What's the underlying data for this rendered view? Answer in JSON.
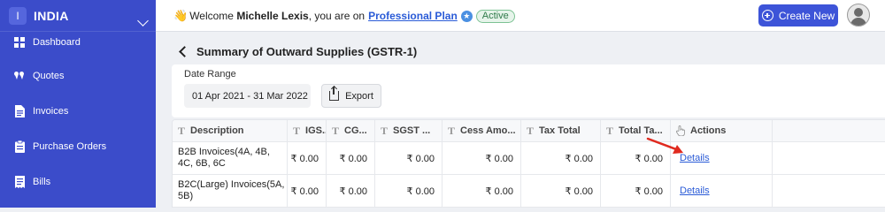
{
  "org": {
    "initial": "I",
    "name": "INDIA"
  },
  "sidebar": {
    "items": [
      {
        "label": "Dashboard",
        "icon": "dashboard-icon"
      },
      {
        "label": "Quotes",
        "icon": "quote-icon"
      },
      {
        "label": "Invoices",
        "icon": "document-icon"
      },
      {
        "label": "Purchase Orders",
        "icon": "clipboard-icon"
      },
      {
        "label": "Bills",
        "icon": "receipt-icon"
      }
    ],
    "color": "#3b4cca"
  },
  "topbar": {
    "welcome_prefix": "Welcome",
    "user_name": "Michelle Lexis",
    "welcome_suffix": ", you are on",
    "plan_name": "Professional Plan",
    "status_badge": "Active",
    "create_button": "Create New",
    "accent": "#3d54d8"
  },
  "page": {
    "title": "Summary of Outward Supplies (GSTR-1)",
    "date_range_label": "Date Range",
    "date_range_value": "01 Apr 2021 - 31 Mar 2022",
    "export_label": "Export"
  },
  "table": {
    "columns": [
      "Description",
      "IGS...",
      "CG...",
      "SGST ...",
      "Cess Amo...",
      "Tax Total",
      "Total Ta...",
      "Actions"
    ],
    "rows": [
      {
        "description": "B2B Invoices(4A, 4B, 4C, 6B, 6C",
        "igst": "₹ 0.00",
        "cgst": "₹ 0.00",
        "sgst": "₹ 0.00",
        "cess": "₹ 0.00",
        "tax_total": "₹ 0.00",
        "total_taxable": "₹ 0.00",
        "action": "Details"
      },
      {
        "description": "B2C(Large) Invoices(5A, 5B)",
        "igst": "₹ 0.00",
        "cgst": "₹ 0.00",
        "sgst": "₹ 0.00",
        "cess": "₹ 0.00",
        "tax_total": "₹ 0.00",
        "total_taxable": "₹ 0.00",
        "action": "Details"
      }
    ]
  },
  "annotation": {
    "arrow_color": "#e02a1f"
  }
}
